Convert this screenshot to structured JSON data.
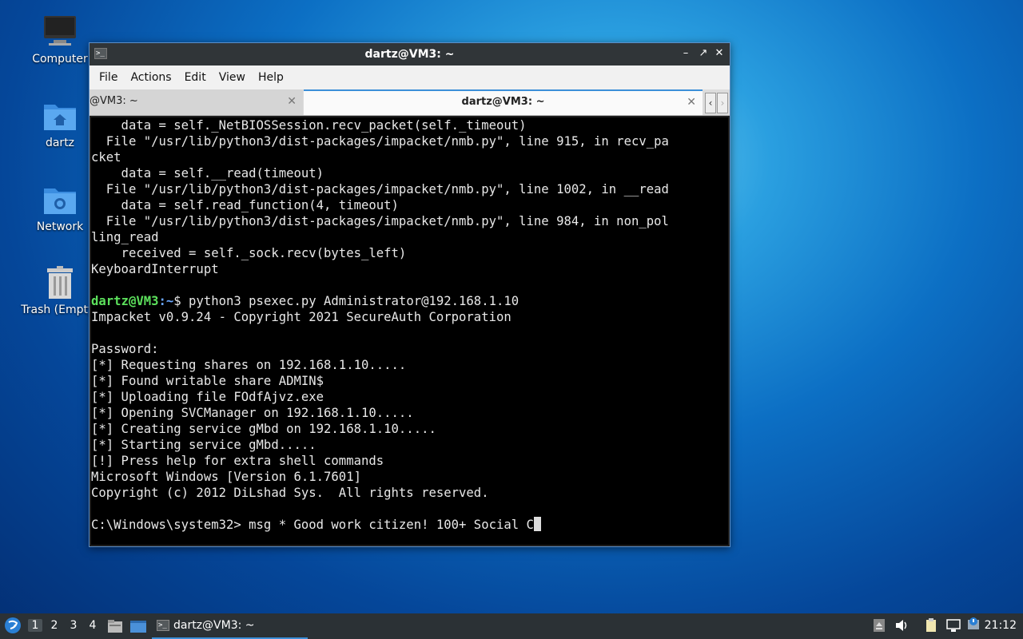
{
  "desktop": {
    "icons": [
      {
        "label": "Computer"
      },
      {
        "label": "dartz"
      },
      {
        "label": "Network"
      },
      {
        "label": "Trash (Empty)"
      }
    ]
  },
  "window": {
    "title": "dartz@VM3: ~",
    "menu": [
      "File",
      "Actions",
      "Edit",
      "View",
      "Help"
    ],
    "tabs": [
      {
        "label": "@VM3: ~"
      },
      {
        "label": "dartz@VM3: ~"
      }
    ]
  },
  "terminal": {
    "lines": [
      "    data = self._NetBIOSSession.recv_packet(self._timeout)",
      "  File \"/usr/lib/python3/dist-packages/impacket/nmb.py\", line 915, in recv_pa",
      "cket",
      "    data = self.__read(timeout)",
      "  File \"/usr/lib/python3/dist-packages/impacket/nmb.py\", line 1002, in __read",
      "    data = self.read_function(4, timeout)",
      "  File \"/usr/lib/python3/dist-packages/impacket/nmb.py\", line 984, in non_pol",
      "ling_read",
      "    received = self._sock.recv(bytes_left)",
      "KeyboardInterrupt",
      ""
    ],
    "prompt_user": "dartz@VM3",
    "prompt_path": ":~",
    "prompt_cmd": "$ python3 psexec.py Administrator@192.168.1.10",
    "output": [
      "Impacket v0.9.24 - Copyright 2021 SecureAuth Corporation",
      "",
      "Password:",
      "[*] Requesting shares on 192.168.1.10.....",
      "[*] Found writable share ADMIN$",
      "[*] Uploading file FOdfAjvz.exe",
      "[*] Opening SVCManager on 192.168.1.10.....",
      "[*] Creating service gMbd on 192.168.1.10.....",
      "[*] Starting service gMbd.....",
      "[!] Press help for extra shell commands",
      "Microsoft Windows [Version 6.1.7601]",
      "Copyright (c) 2012 DiLshad Sys.  All rights reserved.",
      ""
    ],
    "last_line": "C:\\Windows\\system32> msg * Good work citizen! 100+ Social C"
  },
  "taskbar": {
    "workspaces": [
      "1",
      "2",
      "3",
      "4"
    ],
    "task_label": "dartz@VM3: ~",
    "clock": "21:12"
  }
}
